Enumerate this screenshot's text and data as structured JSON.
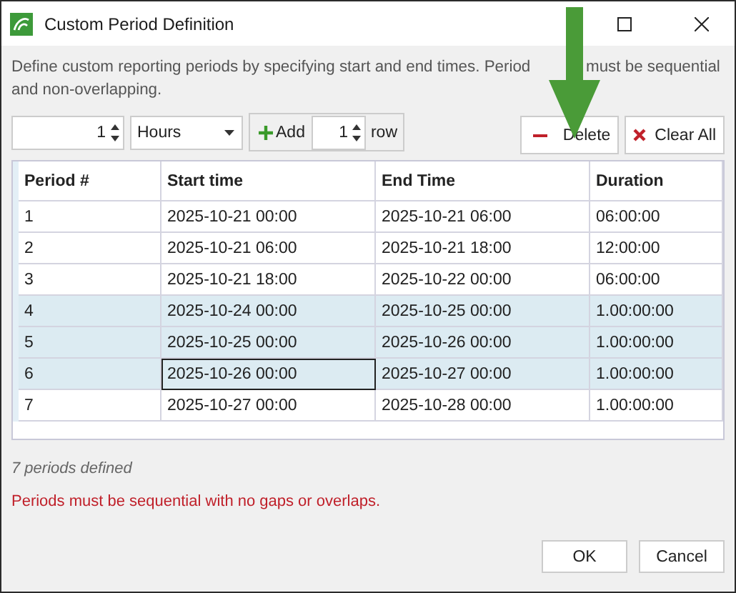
{
  "window": {
    "title": "Custom Period Definition"
  },
  "description": [
    "Define custom reporting periods by specifying start and end times. Period",
    "must be sequential",
    "and non-overlapping."
  ],
  "toolbar": {
    "interval_value": "1",
    "interval_unit": "Hours",
    "add_label": "Add",
    "add_count": "1",
    "row_label": "row",
    "delete_label": "Delete",
    "clear_label": "Clear All"
  },
  "table": {
    "columns": [
      "Period #",
      "Start time",
      "End Time",
      "Duration"
    ],
    "rows": [
      {
        "selected": false,
        "cells": [
          {
            "text": "1",
            "focused": false
          },
          {
            "text": "2025-10-21 00:00",
            "focused": false
          },
          {
            "text": "2025-10-21 06:00",
            "focused": false
          },
          {
            "text": "06:00:00",
            "focused": false
          }
        ]
      },
      {
        "selected": false,
        "cells": [
          {
            "text": "2",
            "focused": false
          },
          {
            "text": "2025-10-21 06:00",
            "focused": false
          },
          {
            "text": "2025-10-21 18:00",
            "focused": false
          },
          {
            "text": "12:00:00",
            "focused": false
          }
        ]
      },
      {
        "selected": false,
        "cells": [
          {
            "text": "3",
            "focused": false
          },
          {
            "text": "2025-10-21 18:00",
            "focused": false
          },
          {
            "text": "2025-10-22 00:00",
            "focused": false
          },
          {
            "text": "06:00:00",
            "focused": false
          }
        ]
      },
      {
        "selected": true,
        "cells": [
          {
            "text": "4",
            "focused": false
          },
          {
            "text": "2025-10-24 00:00",
            "focused": false
          },
          {
            "text": "2025-10-25 00:00",
            "focused": false
          },
          {
            "text": "1.00:00:00",
            "focused": false
          }
        ]
      },
      {
        "selected": true,
        "cells": [
          {
            "text": "5",
            "focused": false
          },
          {
            "text": "2025-10-25 00:00",
            "focused": false
          },
          {
            "text": "2025-10-26 00:00",
            "focused": false
          },
          {
            "text": "1.00:00:00",
            "focused": false
          }
        ]
      },
      {
        "selected": true,
        "cells": [
          {
            "text": "6",
            "focused": false
          },
          {
            "text": "2025-10-26 00:00",
            "focused": true
          },
          {
            "text": "2025-10-27 00:00",
            "focused": false
          },
          {
            "text": "1.00:00:00",
            "focused": false
          }
        ]
      },
      {
        "selected": false,
        "cells": [
          {
            "text": "7",
            "focused": false
          },
          {
            "text": "2025-10-27 00:00",
            "focused": false
          },
          {
            "text": "2025-10-28 00:00",
            "focused": false
          },
          {
            "text": "1.00:00:00",
            "focused": false
          }
        ]
      }
    ]
  },
  "count_text": "7 periods defined",
  "error_text": "Periods must be sequential with no gaps or overlaps.",
  "buttons": [
    "OK",
    "Cancel"
  ]
}
